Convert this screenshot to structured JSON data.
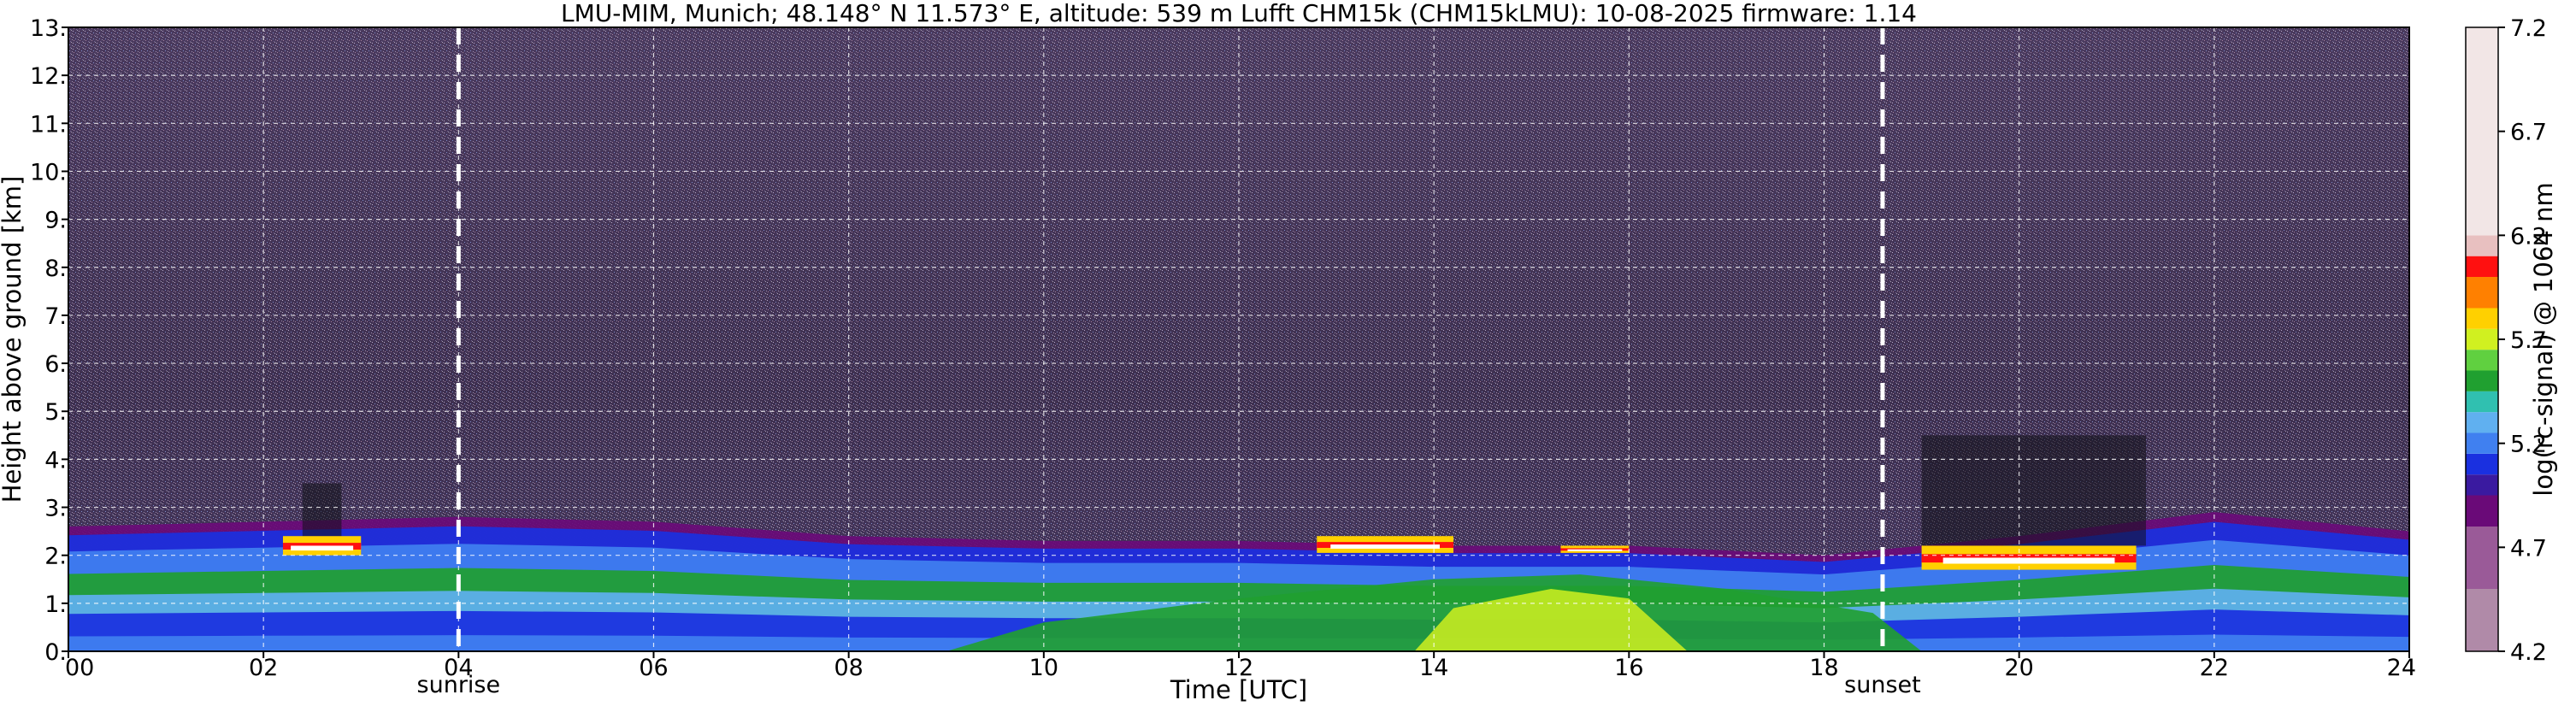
{
  "chart_data": {
    "type": "heatmap",
    "title": "LMU-MIM, Munich; 48.148° N 11.573° E, altitude: 539 m    Lufft CHM15k (CHM15kLMU): 10-08-2025    firmware: 1.14",
    "xlabel": "Time [UTC]",
    "ylabel": "Height above ground [km]",
    "colorbar_label": "log(rc-signal) @ 1064 nm",
    "xlim": [
      0,
      24
    ],
    "ylim": [
      0,
      13
    ],
    "x_ticks": [
      0,
      2,
      4,
      6,
      8,
      10,
      12,
      14,
      16,
      18,
      20,
      22,
      24
    ],
    "x_tick_labels": [
      "00",
      "02",
      "04",
      "06",
      "08",
      "10",
      "12",
      "14",
      "16",
      "18",
      "20",
      "22",
      "24"
    ],
    "y_ticks": [
      0,
      1,
      2,
      3,
      4,
      5,
      6,
      7,
      8,
      9,
      10,
      11,
      12,
      13
    ],
    "y_tick_labels": [
      "0.",
      "1.",
      "2.",
      "3.",
      "4.",
      "5.",
      "6.",
      "7.",
      "8.",
      "9.",
      "10.",
      "11.",
      "12.",
      "13."
    ],
    "colorbar_range": [
      4.2,
      7.2
    ],
    "colorbar_ticks": [
      4.2,
      4.7,
      5.2,
      5.7,
      6.2,
      6.7,
      7.2
    ],
    "colorbar_tick_labels": [
      "4.2",
      "4.7",
      "5.2",
      "5.7",
      "6.2",
      "6.7",
      "7.2"
    ],
    "colorscale": [
      {
        "value": 4.2,
        "color": "#b08aa8"
      },
      {
        "value": 4.5,
        "color": "#9a5a98"
      },
      {
        "value": 4.8,
        "color": "#6a0a78"
      },
      {
        "value": 4.95,
        "color": "#3a1aa0"
      },
      {
        "value": 5.05,
        "color": "#1a30e0"
      },
      {
        "value": 5.15,
        "color": "#4080f0"
      },
      {
        "value": 5.25,
        "color": "#60b0f0"
      },
      {
        "value": 5.35,
        "color": "#30c0b0"
      },
      {
        "value": 5.45,
        "color": "#20a030"
      },
      {
        "value": 5.55,
        "color": "#60d040"
      },
      {
        "value": 5.65,
        "color": "#d0f020"
      },
      {
        "value": 5.75,
        "color": "#ffd000"
      },
      {
        "value": 5.85,
        "color": "#ff8000"
      },
      {
        "value": 6.0,
        "color": "#ff1010"
      },
      {
        "value": 6.1,
        "color": "#e8c0c0"
      },
      {
        "value": 6.2,
        "color": "#f2e6e6"
      },
      {
        "value": 7.2,
        "color": "#ffffff"
      }
    ],
    "grid": true,
    "annotations": [
      {
        "text": "sunrise",
        "x": 4.0,
        "style": "dashed vertical line"
      },
      {
        "text": "sunset",
        "x": 18.6,
        "style": "dashed vertical line"
      }
    ],
    "features": {
      "boundary_layer_top_km": [
        {
          "x": 0,
          "y": 2.6
        },
        {
          "x": 2,
          "y": 2.7
        },
        {
          "x": 4,
          "y": 2.8
        },
        {
          "x": 6,
          "y": 2.7
        },
        {
          "x": 8,
          "y": 2.4
        },
        {
          "x": 10,
          "y": 2.3
        },
        {
          "x": 12,
          "y": 2.3
        },
        {
          "x": 14,
          "y": 2.2
        },
        {
          "x": 16,
          "y": 2.2
        },
        {
          "x": 18,
          "y": 2.0
        },
        {
          "x": 20,
          "y": 2.4
        },
        {
          "x": 22,
          "y": 2.9
        },
        {
          "x": 24,
          "y": 2.5
        }
      ],
      "cloud_layers": [
        {
          "x_start": 2.2,
          "x_end": 3.0,
          "base_km": 2.0,
          "top_km": 2.4
        },
        {
          "x_start": 12.8,
          "x_end": 14.2,
          "base_km": 2.05,
          "top_km": 2.4
        },
        {
          "x_start": 15.3,
          "x_end": 16.0,
          "base_km": 2.05,
          "top_km": 2.2
        },
        {
          "x_start": 19.0,
          "x_end": 21.2,
          "base_km": 1.7,
          "top_km": 2.2
        }
      ],
      "precip_columns": [
        {
          "x_start": 19.0,
          "x_end": 21.3,
          "top_km": 4.5
        },
        {
          "x_start": 2.4,
          "x_end": 2.8,
          "top_km": 3.5
        }
      ]
    }
  }
}
